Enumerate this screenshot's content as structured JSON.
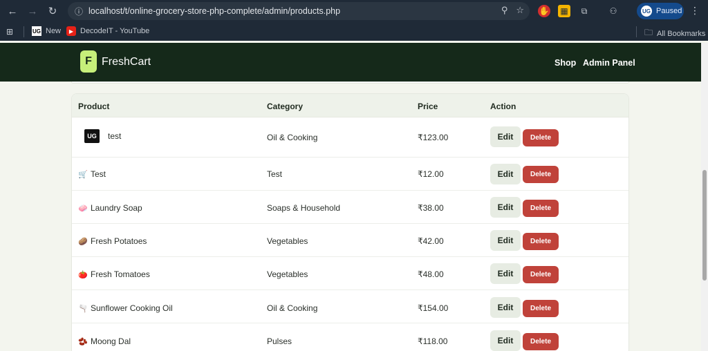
{
  "browser": {
    "url": "localhost/t/online-grocery-store-php-complete/admin/products.php",
    "profile_label": "Paused",
    "profile_initials": "UG"
  },
  "bookmarks": {
    "items": [
      {
        "label": "New",
        "fav": "UG"
      },
      {
        "label": "DecodeIT - YouTube",
        "fav": "▶"
      }
    ],
    "all_label": "All Bookmarks"
  },
  "site": {
    "logo_letter": "F",
    "brand": "FreshCart",
    "nav": [
      "Shop",
      "Admin Panel"
    ],
    "colors": {
      "header_bg": "#15291a",
      "accent": "#c6ef7a",
      "delete": "#c0423a"
    }
  },
  "table": {
    "headers": [
      "Product",
      "Category",
      "Price",
      "Action"
    ],
    "edit_label": "Edit",
    "delete_label": "Delete",
    "rows": [
      {
        "name": "test",
        "icon": "UG",
        "category": "Oil & Cooking",
        "price": "₹123.00"
      },
      {
        "name": "Test",
        "icon": "🛒",
        "category": "Test",
        "price": "₹12.00"
      },
      {
        "name": "Laundry Soap",
        "icon": "🧼",
        "category": "Soaps & Household",
        "price": "₹38.00"
      },
      {
        "name": "Fresh Potatoes",
        "icon": "🥔",
        "category": "Vegetables",
        "price": "₹42.00"
      },
      {
        "name": "Fresh Tomatoes",
        "icon": "🍅",
        "category": "Vegetables",
        "price": "₹48.00"
      },
      {
        "name": "Sunflower Cooking Oil",
        "icon": "🫗",
        "category": "Oil & Cooking",
        "price": "₹154.00"
      },
      {
        "name": "Moong Dal",
        "icon": "🫘",
        "category": "Pulses",
        "price": "₹118.00"
      }
    ]
  }
}
